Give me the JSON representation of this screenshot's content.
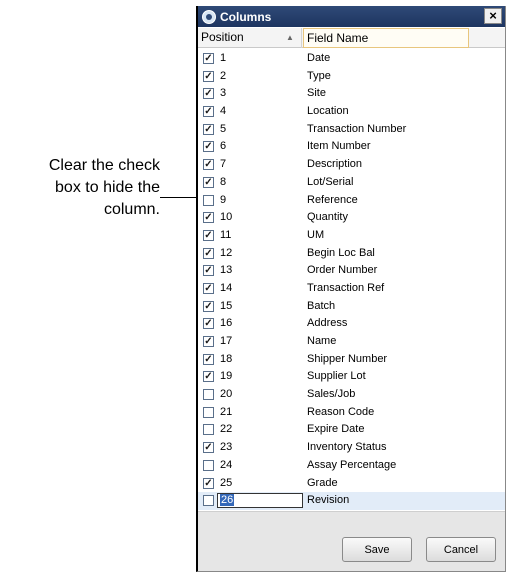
{
  "callout": {
    "lines": [
      "Clear the check",
      "box to hide the",
      "column."
    ]
  },
  "dialog": {
    "title": "Columns",
    "close_label": "×",
    "headers": {
      "position": "Position",
      "field_name": "Field Name"
    },
    "rows": [
      {
        "pos": "1",
        "name": "Date",
        "checked": true
      },
      {
        "pos": "2",
        "name": "Type",
        "checked": true
      },
      {
        "pos": "3",
        "name": "Site",
        "checked": true
      },
      {
        "pos": "4",
        "name": "Location",
        "checked": true
      },
      {
        "pos": "5",
        "name": "Transaction Number",
        "checked": true
      },
      {
        "pos": "6",
        "name": "Item Number",
        "checked": true
      },
      {
        "pos": "7",
        "name": "Description",
        "checked": true
      },
      {
        "pos": "8",
        "name": "Lot/Serial",
        "checked": true
      },
      {
        "pos": "9",
        "name": "Reference",
        "checked": false
      },
      {
        "pos": "10",
        "name": "Quantity",
        "checked": true
      },
      {
        "pos": "11",
        "name": "UM",
        "checked": true
      },
      {
        "pos": "12",
        "name": "Begin Loc Bal",
        "checked": true
      },
      {
        "pos": "13",
        "name": "Order Number",
        "checked": true
      },
      {
        "pos": "14",
        "name": "Transaction Ref",
        "checked": true
      },
      {
        "pos": "15",
        "name": "Batch",
        "checked": true
      },
      {
        "pos": "16",
        "name": "Address",
        "checked": true
      },
      {
        "pos": "17",
        "name": "Name",
        "checked": true
      },
      {
        "pos": "18",
        "name": "Shipper Number",
        "checked": true
      },
      {
        "pos": "19",
        "name": "Supplier Lot",
        "checked": true
      },
      {
        "pos": "20",
        "name": "Sales/Job",
        "checked": false
      },
      {
        "pos": "21",
        "name": "Reason Code",
        "checked": false
      },
      {
        "pos": "22",
        "name": "Expire Date",
        "checked": false
      },
      {
        "pos": "23",
        "name": "Inventory Status",
        "checked": true
      },
      {
        "pos": "24",
        "name": "Assay Percentage",
        "checked": false
      },
      {
        "pos": "25",
        "name": "Grade",
        "checked": true
      },
      {
        "pos": "26",
        "name": "Revision",
        "checked": false,
        "editing": true
      }
    ],
    "buttons": {
      "save": "Save",
      "cancel": "Cancel"
    }
  }
}
